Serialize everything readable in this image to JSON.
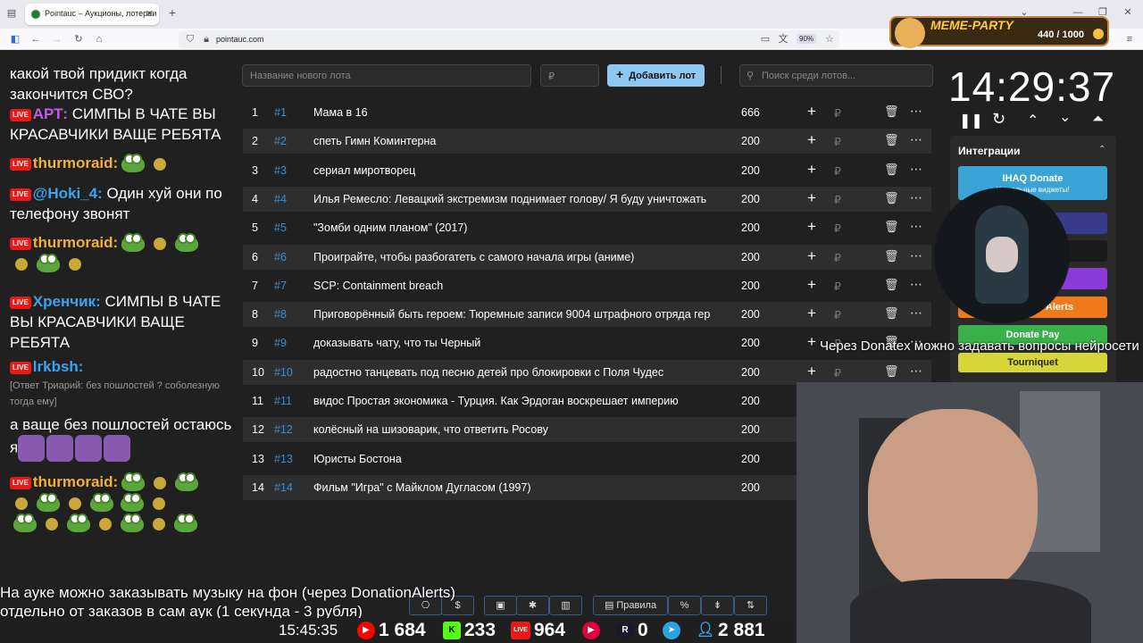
{
  "browser": {
    "tab_title": "Pointauc – Аукционы, лотереи",
    "url": "pointauc.com",
    "zoom": "90%",
    "extension": {
      "title": "MEME-PARTY",
      "count": "440 / 1000"
    }
  },
  "chat": {
    "top_line": "какой твой придикт когда закончится СВО?",
    "m1_nick": "АРТ:",
    "m1_text": "СИМПЫ В ЧАТЕ ВЫ КРАСАВЧИКИ ВАЩЕ РЕБЯТА",
    "m2_nick": "thurmoraid:",
    "m3_nick": "@Hoki_4:",
    "m3_text": "Один хуй они по телефону звонят",
    "m4_nick": "thurmoraid:",
    "m5_nick": "Хренчик:",
    "m5_text": "СИМПЫ В ЧАТЕ ВЫ КРАСАВЧИКИ ВАЩЕ РЕБЯТА",
    "m6_nick": "lrkbsh:",
    "m6_reply": "[Ответ Триарий: без пошлостей ? соболезную тогда ему]",
    "m6_text": "а ваще без пошлостей остаюсь я",
    "m7_nick": "thurmoraid:",
    "live_badge": "LIVE"
  },
  "auction": {
    "new_lot_placeholder": "Название нового лота",
    "amount_placeholder": "₽",
    "add_label": "Добавить лот",
    "search_placeholder": "Поиск среди лотов...",
    "currency": "₽",
    "lots": [
      {
        "n": "1",
        "id": "#1",
        "name": "Мама в 16",
        "amount": "666"
      },
      {
        "n": "2",
        "id": "#2",
        "name": "спеть Гимн Коминтерна",
        "amount": "200"
      },
      {
        "n": "3",
        "id": "#3",
        "name": "сериал миротворец",
        "amount": "200"
      },
      {
        "n": "4",
        "id": "#4",
        "name": "Илья Ремесло: Левацкий экстремизм поднимает голову/ Я буду уничтожать",
        "amount": "200"
      },
      {
        "n": "5",
        "id": "#5",
        "name": "\"Зомби одним планом\" (2017)",
        "amount": "200"
      },
      {
        "n": "6",
        "id": "#6",
        "name": "Проиграйте, чтобы разбогатеть с самого начала игры (аниме)",
        "amount": "200"
      },
      {
        "n": "7",
        "id": "#7",
        "name": "SCP: Containment breach",
        "amount": "200"
      },
      {
        "n": "8",
        "id": "#8",
        "name": "Приговорённый быть героем: Тюремные записи 9004 штрафного отряда гер",
        "amount": "200"
      },
      {
        "n": "9",
        "id": "#9",
        "name": "доказывать чату, что ты Черный",
        "amount": "200"
      },
      {
        "n": "10",
        "id": "#10",
        "name": "радостно танцевать под песню детей про блокировки с Поля Чудес",
        "amount": "200"
      },
      {
        "n": "11",
        "id": "#11",
        "name": "видос Простая экономика - Турция. Как Эрдоган воскрешает империю",
        "amount": "200"
      },
      {
        "n": "12",
        "id": "#12",
        "name": "колёсный на шизоварик, что ответить Росову",
        "amount": "200"
      },
      {
        "n": "13",
        "id": "#13",
        "name": "Юристы Бостона",
        "amount": "200"
      },
      {
        "n": "14",
        "id": "#14",
        "name": "Фильм \"Игра\" с Майклом Дугласом (1997)",
        "amount": "200"
      }
    ]
  },
  "timer": {
    "value": "14:29:37"
  },
  "integrations": {
    "title": "Интеграции",
    "ihaq": "IHAQ Donate",
    "ihaq_sub": "Уникальные виджеты!",
    "donationalerts": "Alerts",
    "donatepay": "Donate Pay",
    "tourniquet": "Tourniquet"
  },
  "overlay": {
    "ticker_right": "Через Donatex можно задавать вопросы нейросети",
    "subtitle_line1": "На ауке можно заказывать музыку на фон (через DonationAlerts)",
    "subtitle_line2": "отдельно от заказов в сам аук (1 секунда - 3 рубля)",
    "rules_label": "Правила"
  },
  "stats": {
    "time": "15:45:35",
    "youtube": "1 684",
    "kick": "233",
    "live": "964",
    "rutube": "0",
    "total": "2 881",
    "colors": {
      "youtube": "#ff0000",
      "kick": "#53fc18",
      "live": "#e91916",
      "telegram": "#2aa3e0"
    }
  }
}
